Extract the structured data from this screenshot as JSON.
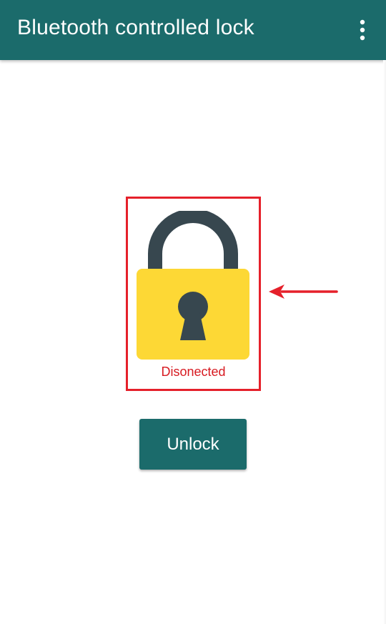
{
  "appbar": {
    "title": "Bluetooth controlled lock",
    "background_color": "#1b6b6b",
    "menu_icon": "more-vert-icon"
  },
  "lock": {
    "icon": "padlock-icon",
    "body_color": "#fdd835",
    "shackle_color": "#37474f",
    "status_text": "Disonected",
    "status_color": "#d71a21",
    "highlight_color": "#e5202a"
  },
  "annotation": {
    "icon": "arrow-left-icon",
    "color": "#e5202a"
  },
  "actions": {
    "unlock_label": "Unlock"
  }
}
